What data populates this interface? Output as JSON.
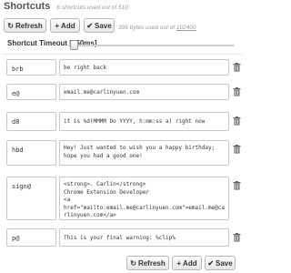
{
  "header": {
    "title": "Shortcuts",
    "subtitle": "6 shortcuts used out of 510"
  },
  "toolbar": {
    "refresh_label": "Refresh",
    "add_label": "Add",
    "save_label": "Save",
    "refresh_icon": "refresh-icon",
    "add_icon": "plus-icon",
    "save_icon": "checkmark-icon"
  },
  "storage": {
    "used_text": "395 bytes used out of",
    "limit": "102400"
  },
  "timeout": {
    "label": "Shortcut Timeout [750ms]",
    "value_ms": 750
  },
  "shortcuts": [
    {
      "abbr": "brb",
      "expansion": "be right back"
    },
    {
      "abbr": "e@",
      "expansion": "email.me@carlinyuen.com"
    },
    {
      "abbr": "d8",
      "expansion": "it is %d(MMMM Do YYYY, h:mm:ss a) right now"
    },
    {
      "abbr": "hbd",
      "expansion": "Hey! Just wanted to wish you a happy birthday; hope you had a good one!"
    },
    {
      "abbr": "sign@",
      "expansion": "<strong>. Carlin</strong>\nChrome Extension Developer\n<a href=\"mailto:email.me@carlinyuen.com\">email.me@carlinyuen.com</a>"
    },
    {
      "abbr": "p@",
      "expansion": "This is your final warning: %clip%"
    }
  ],
  "footer": {
    "refresh_label": "Refresh",
    "add_label": "Add",
    "save_label": "Save"
  },
  "colors": {
    "accent": "#2a7ab8",
    "text": "#333333",
    "muted": "#999999"
  }
}
